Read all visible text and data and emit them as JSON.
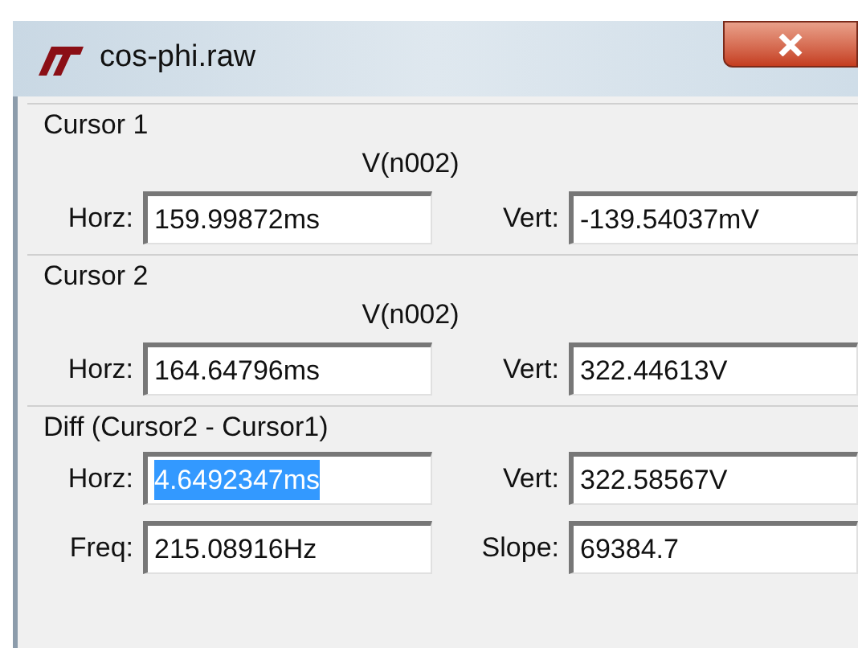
{
  "window": {
    "title": "cos-phi.raw"
  },
  "groups": [
    {
      "title": "Cursor 1",
      "trace": "V(n002)",
      "rows": [
        [
          {
            "label": "Horz:",
            "value": "159.99872ms",
            "selected": false
          },
          {
            "label": "Vert:",
            "value": "-139.54037mV",
            "selected": false
          }
        ]
      ]
    },
    {
      "title": "Cursor 2",
      "trace": "V(n002)",
      "rows": [
        [
          {
            "label": "Horz:",
            "value": "164.64796ms",
            "selected": false
          },
          {
            "label": "Vert:",
            "value": "322.44613V",
            "selected": false
          }
        ]
      ]
    },
    {
      "title": "Diff (Cursor2 - Cursor1)",
      "rows": [
        [
          {
            "label": "Horz:",
            "value": "4.6492347ms",
            "selected": true
          },
          {
            "label": "Vert:",
            "value": "322.58567V",
            "selected": false
          }
        ],
        [
          {
            "label": "Freq:",
            "value": "215.08916Hz",
            "selected": false
          },
          {
            "label": "Slope:",
            "value": "69384.7",
            "selected": false
          }
        ]
      ]
    }
  ]
}
